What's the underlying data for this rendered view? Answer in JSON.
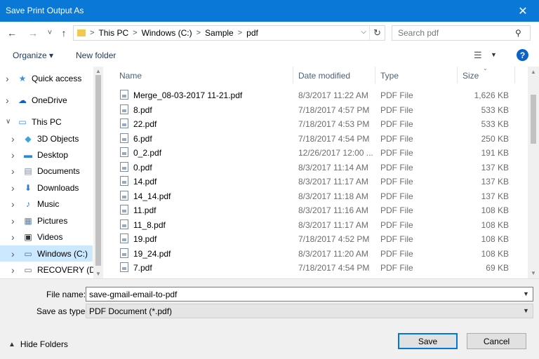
{
  "window": {
    "title": "Save Print Output As",
    "close_glyph": "✕"
  },
  "nav": {
    "back_glyph": "←",
    "forward_glyph": "→",
    "recent_glyph": "˅",
    "up_glyph": "↑",
    "breadcrumb": [
      "This PC",
      "Windows (C:)",
      "Sample",
      "pdf"
    ],
    "search_placeholder": "Search pdf"
  },
  "toolbar": {
    "organize_label": "Organize ▾",
    "new_folder_label": "New folder",
    "help_label": "?"
  },
  "sidebar": {
    "items": [
      {
        "label": "Quick access",
        "icon": "star-icon",
        "glyph": "★",
        "color": "#3c8ee6",
        "level": 0
      },
      {
        "label": "OneDrive",
        "icon": "cloud-icon",
        "glyph": "☁",
        "color": "#0a63c9",
        "level": 0
      },
      {
        "label": "This PC",
        "icon": "computer-icon",
        "glyph": "▭",
        "color": "#3c8ee6",
        "level": 0,
        "expanded": true
      },
      {
        "label": "3D Objects",
        "icon": "cube-icon",
        "glyph": "◆",
        "color": "#39a6d9",
        "level": 1
      },
      {
        "label": "Desktop",
        "icon": "desktop-icon",
        "glyph": "▬",
        "color": "#2b88d8",
        "level": 1
      },
      {
        "label": "Documents",
        "icon": "document-icon",
        "glyph": "▤",
        "color": "#7b8a9c",
        "level": 1
      },
      {
        "label": "Downloads",
        "icon": "download-icon",
        "glyph": "⬇",
        "color": "#2b7cd3",
        "level": 1
      },
      {
        "label": "Music",
        "icon": "music-icon",
        "glyph": "♪",
        "color": "#2b7cd3",
        "level": 1
      },
      {
        "label": "Pictures",
        "icon": "picture-icon",
        "glyph": "▦",
        "color": "#5a7a9a",
        "level": 1
      },
      {
        "label": "Videos",
        "icon": "video-icon",
        "glyph": "▣",
        "color": "#333333",
        "level": 1
      },
      {
        "label": "Windows (C:)",
        "icon": "drive-icon",
        "glyph": "▭",
        "color": "#4a6f96",
        "level": 1,
        "selected": true
      },
      {
        "label": "RECOVERY (D:)",
        "icon": "drive-icon",
        "glyph": "▭",
        "color": "#6f6f6f",
        "level": 1
      }
    ]
  },
  "columns": {
    "name": "Name",
    "date": "Date modified",
    "type": "Type",
    "size": "Size"
  },
  "files": [
    {
      "name": "Merge_08-03-2017 11-21.pdf",
      "date": "8/3/2017 11:22 AM",
      "type": "PDF File",
      "size": "1,626 KB"
    },
    {
      "name": "8.pdf",
      "date": "7/18/2017 4:57 PM",
      "type": "PDF File",
      "size": "533 KB"
    },
    {
      "name": "22.pdf",
      "date": "7/18/2017 4:53 PM",
      "type": "PDF File",
      "size": "533 KB"
    },
    {
      "name": "6.pdf",
      "date": "7/18/2017 4:54 PM",
      "type": "PDF File",
      "size": "250 KB"
    },
    {
      "name": "0_2.pdf",
      "date": "12/26/2017 12:00 ...",
      "type": "PDF File",
      "size": "191 KB"
    },
    {
      "name": "0.pdf",
      "date": "8/3/2017 11:14 AM",
      "type": "PDF File",
      "size": "137 KB"
    },
    {
      "name": "14.pdf",
      "date": "8/3/2017 11:17 AM",
      "type": "PDF File",
      "size": "137 KB"
    },
    {
      "name": "14_14.pdf",
      "date": "8/3/2017 11:18 AM",
      "type": "PDF File",
      "size": "137 KB"
    },
    {
      "name": "11.pdf",
      "date": "8/3/2017 11:16 AM",
      "type": "PDF File",
      "size": "108 KB"
    },
    {
      "name": "11_8.pdf",
      "date": "8/3/2017 11:17 AM",
      "type": "PDF File",
      "size": "108 KB"
    },
    {
      "name": "19.pdf",
      "date": "7/18/2017 4:52 PM",
      "type": "PDF File",
      "size": "108 KB"
    },
    {
      "name": "19_24.pdf",
      "date": "8/3/2017 11:20 AM",
      "type": "PDF File",
      "size": "108 KB"
    },
    {
      "name": "7.pdf",
      "date": "7/18/2017 4:54 PM",
      "type": "PDF File",
      "size": "69 KB"
    }
  ],
  "form": {
    "filename_label": "File name:",
    "filename_value": "save-gmail-email-to-pdf",
    "savetype_label": "Save as type:",
    "savetype_value": "PDF Document (*.pdf)"
  },
  "footer": {
    "hide_folders_label": "Hide Folders",
    "save_label": "Save",
    "cancel_label": "Cancel"
  },
  "colors": {
    "titlebar": "#0a78d7",
    "selected": "#cce8ff",
    "accent": "#0078d7"
  }
}
